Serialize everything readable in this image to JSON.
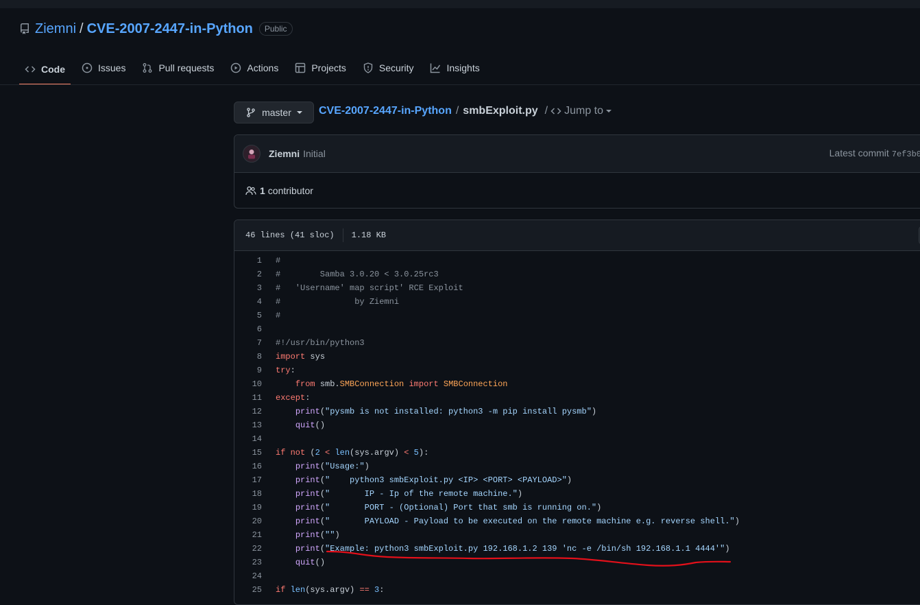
{
  "repo": {
    "owner": "Ziemni",
    "name": "CVE-2007-2447-in-Python",
    "visibility": "Public"
  },
  "tabs": [
    {
      "label": "Code",
      "icon": "code-icon"
    },
    {
      "label": "Issues",
      "icon": "issue-icon"
    },
    {
      "label": "Pull requests",
      "icon": "pull-request-icon"
    },
    {
      "label": "Actions",
      "icon": "play-icon"
    },
    {
      "label": "Projects",
      "icon": "table-icon"
    },
    {
      "label": "Security",
      "icon": "shield-icon"
    },
    {
      "label": "Insights",
      "icon": "graph-icon"
    }
  ],
  "branch": "master",
  "breadcrumb": {
    "repo": "CVE-2007-2447-in-Python",
    "separator": "/",
    "file": "smbExploit.py",
    "jump_sep": "/",
    "jump": "Jump to"
  },
  "commit": {
    "author": "Ziemni",
    "message": "Initial",
    "latest_label": "Latest commit",
    "sha": "7ef3b0"
  },
  "contributors": {
    "count": "1",
    "label": "contributor"
  },
  "file": {
    "lines_info": "46 lines (41 sloc)",
    "size": "1.18 KB"
  },
  "accent": {
    "tab_underline": "#f78166",
    "link": "#58a6ff",
    "annotation": "#e3101a"
  }
}
